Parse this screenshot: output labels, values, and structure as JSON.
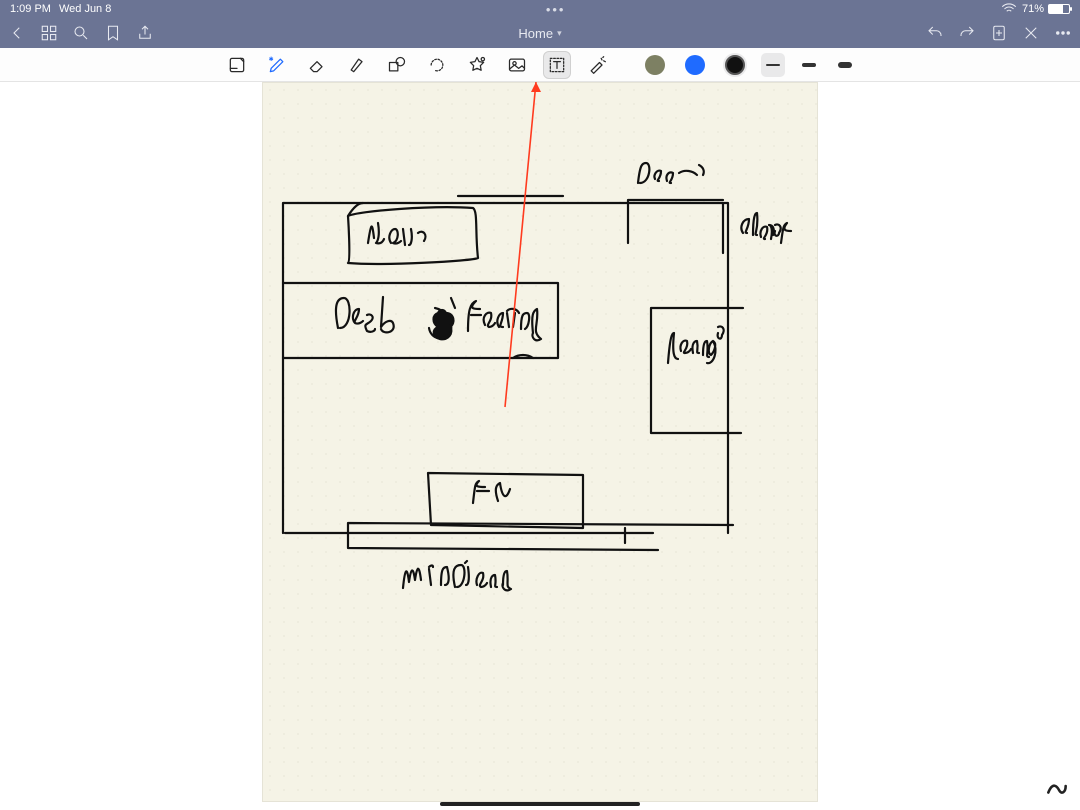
{
  "status": {
    "time": "1:09 PM",
    "date": "Wed Jun 8",
    "wifi_icon": "wifi",
    "battery_pct": "71%"
  },
  "nav": {
    "title": "Home"
  },
  "toolbar": {
    "read_mode_label": "Read mode",
    "pen_label": "Pen",
    "eraser_label": "Eraser",
    "highlighter_label": "Highlighter",
    "shape_label": "Shape",
    "lasso_label": "Lasso",
    "favorites_label": "Favorites",
    "image_label": "Image",
    "text_label": "Text",
    "pointer_label": "Presentation",
    "color1": "#7d8063",
    "color2": "#1f6bff",
    "color3": "#000000"
  },
  "canvas": {
    "annotations": {
      "door": "Door",
      "closet": "closet",
      "chair": "Chair",
      "desk": "desk",
      "facing": "facing",
      "lounge": "lounge",
      "tv": "tv",
      "windows": "Windows"
    }
  }
}
